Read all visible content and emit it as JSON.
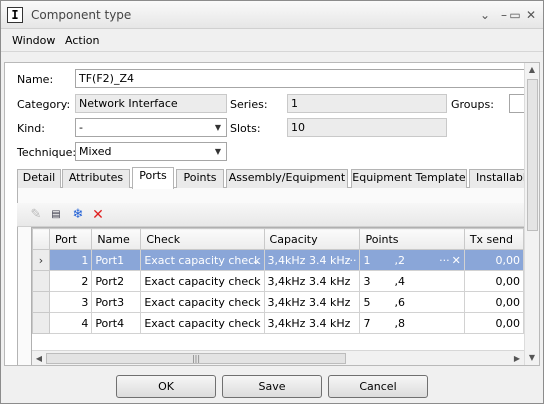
{
  "window": {
    "title": "Component type",
    "app_icon_glyph": "I",
    "controls": [
      "⌄",
      "–",
      "▭",
      "✕"
    ]
  },
  "menu": [
    "Window",
    "Action"
  ],
  "form": {
    "name_label": "Name:",
    "name_value": "TF(F2)_Z4",
    "category_label": "Category:",
    "category_value": "Network Interface",
    "series_label": "Series:",
    "series_value": "1",
    "groups_label": "Groups:",
    "groups_value": "",
    "kind_label": "Kind:",
    "kind_value": "-",
    "slots_label": "Slots:",
    "slots_value": "10",
    "technique_label": "Technique:",
    "technique_value": "Mixed"
  },
  "tabs": [
    "Detail",
    "Attributes",
    "Ports",
    "Points",
    "Assembly/Equipment",
    "Equipment Template",
    "Installable i"
  ],
  "active_tab": "Ports",
  "toolbar": {
    "icons": [
      "edit-icon",
      "save-icon",
      "snowflake-icon",
      "delete-icon"
    ],
    "snowflake_glyph": "❄",
    "delete_glyph": "✕"
  },
  "grid": {
    "columns": [
      "Port",
      "Name",
      "Check",
      "Capacity",
      "Points",
      "Tx send"
    ],
    "row_indicator": "›",
    "rows": [
      {
        "port": "1",
        "name": "Port1",
        "check": "Exact capacity check",
        "capacity": "3,4kHz 3.4 kHz",
        "points_a": "1",
        "points_b": ",2",
        "tx": "0,00"
      },
      {
        "port": "2",
        "name": "Port2",
        "check": "Exact capacity check",
        "capacity": "3,4kHz 3.4 kHz",
        "points_a": "3",
        "points_b": ",4",
        "tx": "0,00"
      },
      {
        "port": "3",
        "name": "Port3",
        "check": "Exact capacity check",
        "capacity": "3,4kHz 3.4 kHz",
        "points_a": "5",
        "points_b": ",6",
        "tx": "0,00"
      },
      {
        "port": "4",
        "name": "Port4",
        "check": "Exact capacity check",
        "capacity": "3,4kHz 3.4 kHz",
        "points_a": "7",
        "points_b": ",8",
        "tx": "0,00"
      }
    ],
    "selected_row": 0,
    "check_dropdown_glyph": "⌄",
    "ellipsis_glyph": "···",
    "clear_glyph": "✕"
  },
  "buttons": {
    "ok": "OK",
    "save": "Save",
    "cancel": "Cancel"
  },
  "colors": {
    "selection": "#8aa6d8",
    "delete": "#e02020",
    "snowflake": "#1f5fd6"
  }
}
